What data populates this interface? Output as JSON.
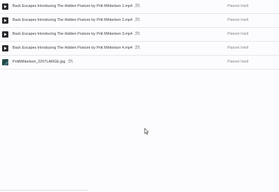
{
  "files": [
    {
      "name": "Back Escapes Introducing The Hidden Posture by Priit Mihkelson 1.mp4",
      "owner": "Planoet Intell",
      "type": "video",
      "shared": true,
      "shared_icon": "shared-people-icon",
      "thumb_icon": "play-icon"
    },
    {
      "name": "Back Escapes Introducing The Hidden Posture by Priit Mihkelson 2.mp4",
      "owner": "Planoet Intell",
      "type": "video",
      "shared": true,
      "shared_icon": "shared-people-icon",
      "thumb_icon": "play-icon"
    },
    {
      "name": "Back Escapes Introducing The Hidden Posture by Priit Mihkelson 3.mp4",
      "owner": "Planoet Intell",
      "type": "video",
      "shared": true,
      "shared_icon": "shared-people-icon",
      "thumb_icon": "play-icon"
    },
    {
      "name": "Back Escapes Introducing The Hidden Posture by Priit Mihkelson 4.mp4",
      "owner": "Planoet Intell",
      "type": "video",
      "shared": true,
      "shared_icon": "shared-people-icon",
      "thumb_icon": "play-icon"
    },
    {
      "name": "PriitMihkelson_2207LARGE.jpg",
      "owner": "Planoet Intell",
      "type": "image",
      "shared": true,
      "shared_icon": "shared-people-icon",
      "thumb_icon": "image-thumbnail"
    }
  ],
  "colors": {
    "background": "#fcfbfd",
    "text_primary": "#3c4043",
    "text_secondary": "#80868b",
    "divider": "#e7e6ea",
    "video_thumb": "#2b2b2f"
  }
}
